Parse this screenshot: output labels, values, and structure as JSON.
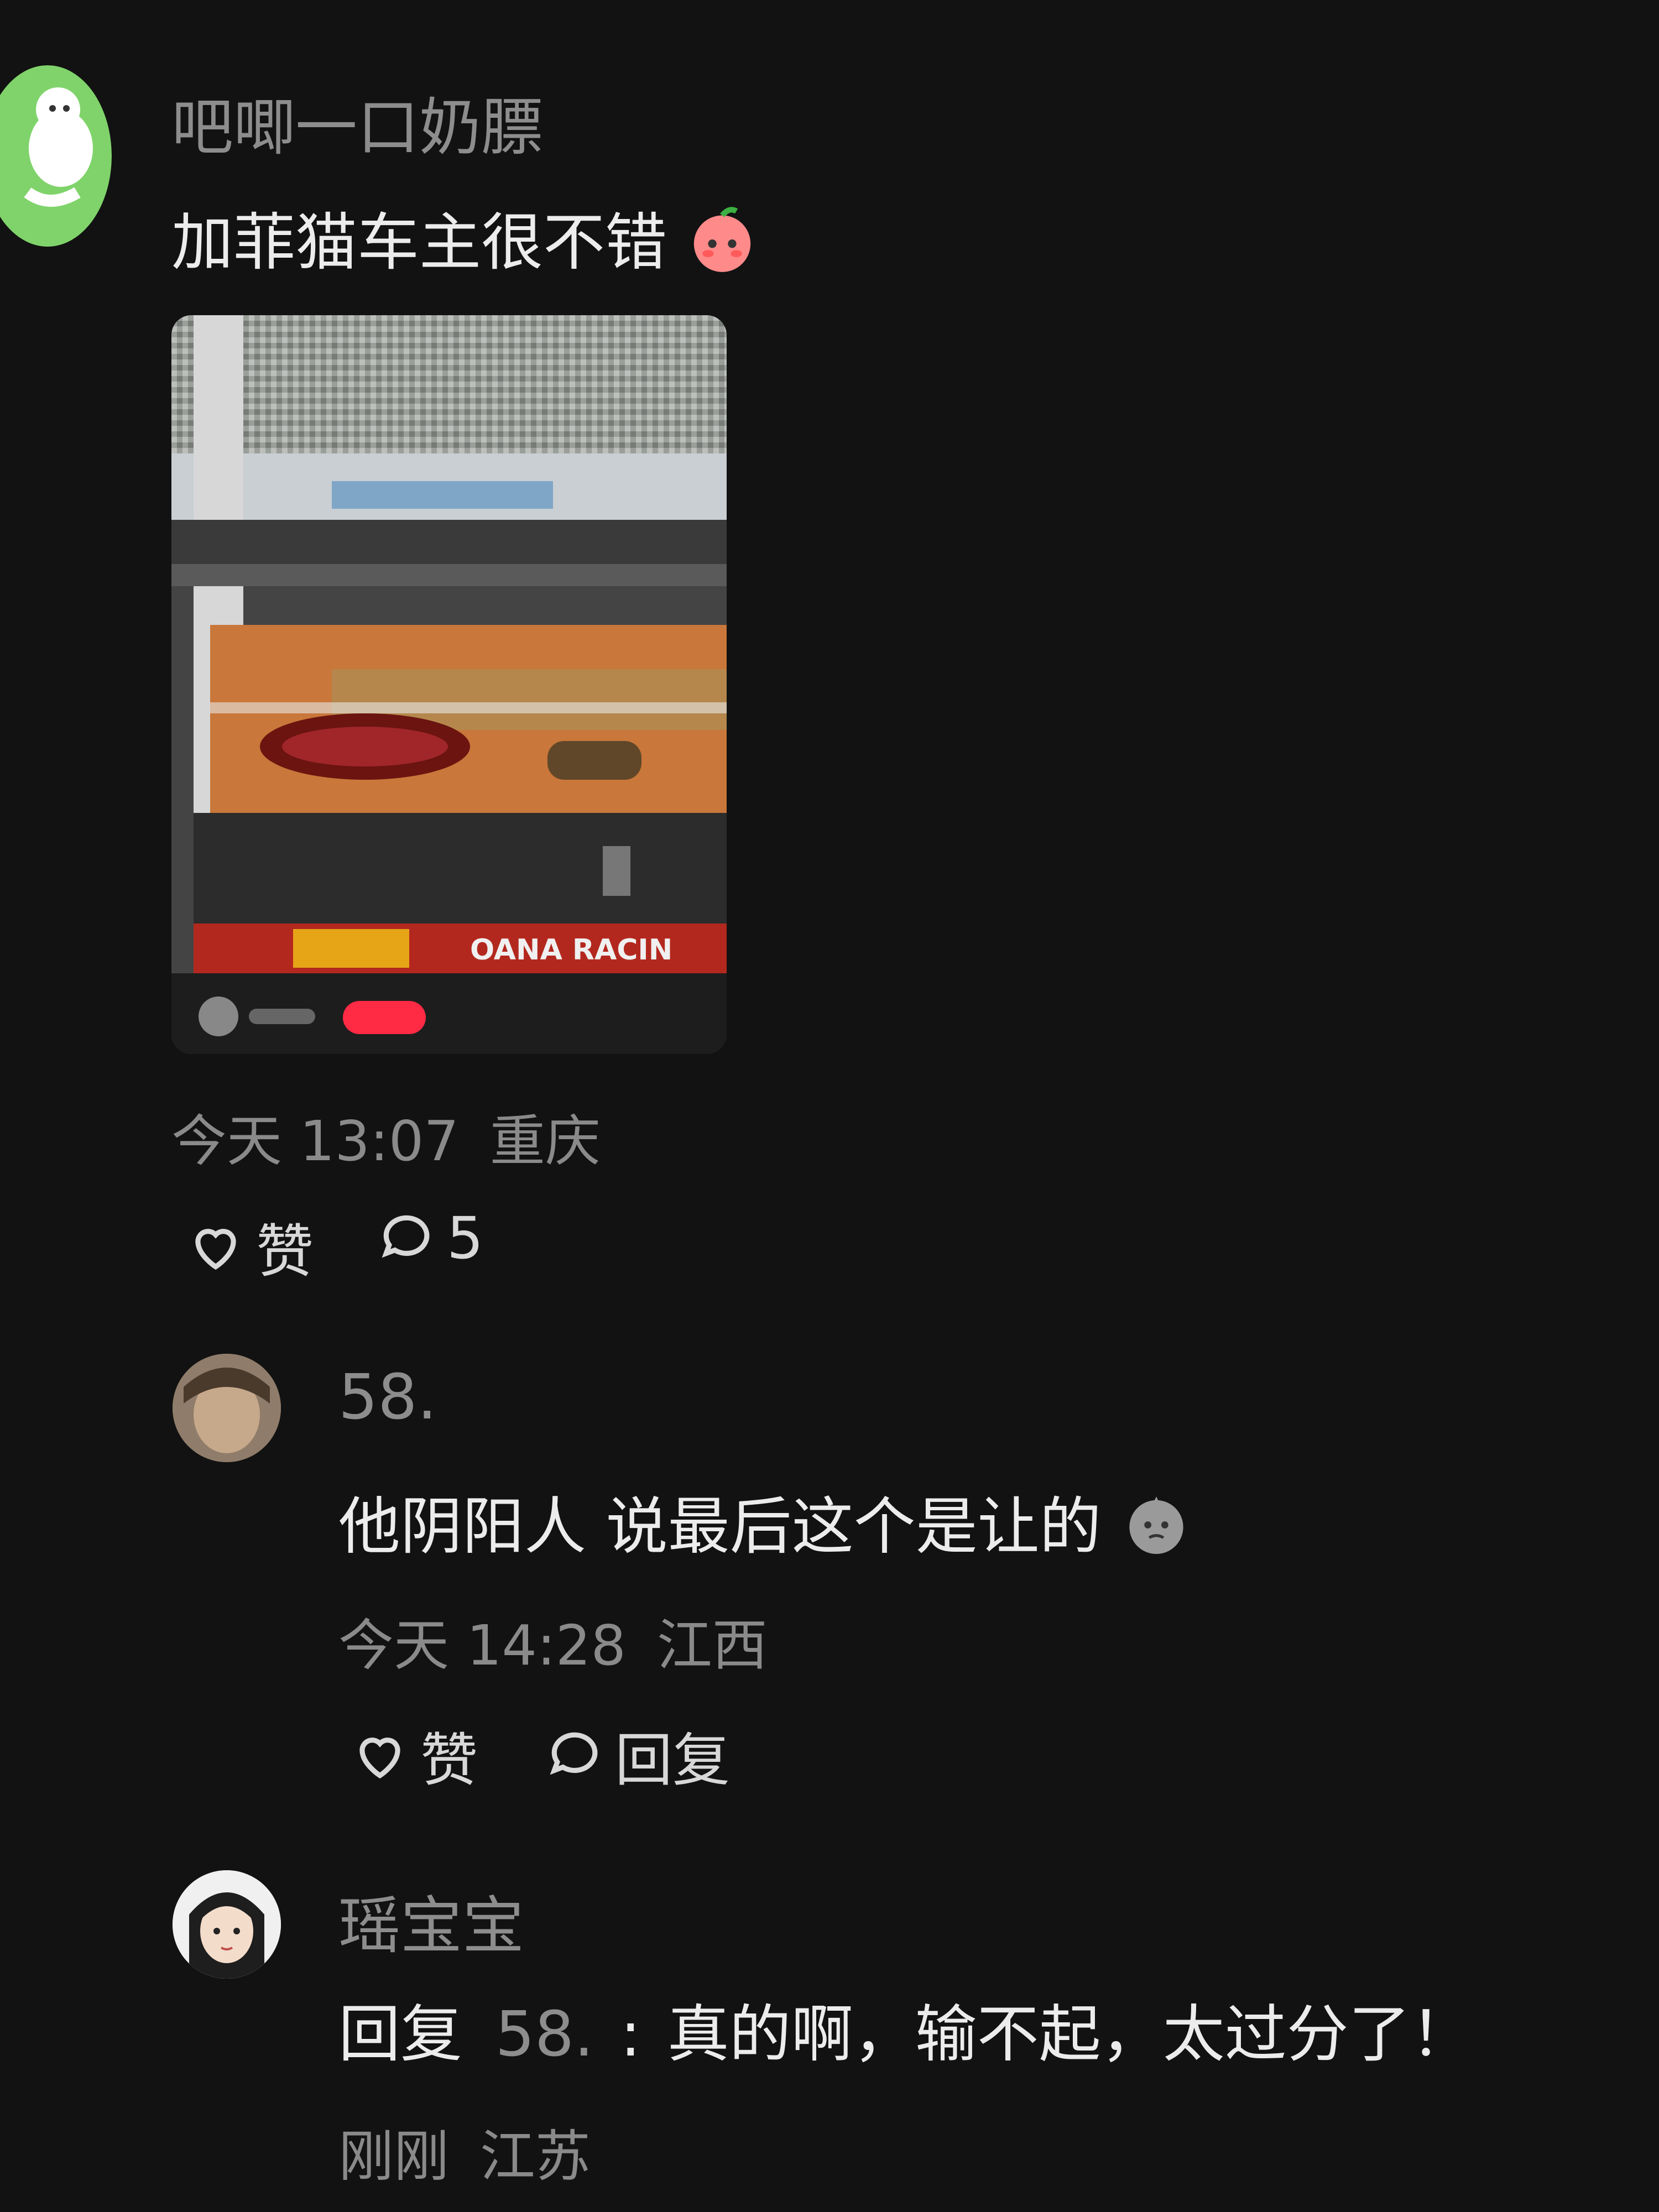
{
  "post": {
    "author": "吧唧一口奶膘",
    "text": "加菲猫车主很不错",
    "emoji_icon": "peach-blush-emoji",
    "image": {
      "plate_text": "OANA RACIN",
      "badge_color": "#ff2a44"
    },
    "timestamp": "今天 13:07",
    "location": "重庆",
    "like_label": "赞",
    "comment_count": "5"
  },
  "replies": [
    {
      "author": "58.",
      "text": "他阴阳人 说最后这个是让的",
      "emoji_icon": "grey-face-emoji",
      "timestamp": "今天 14:28",
      "location": "江西",
      "like_label": "赞",
      "reply_label": "回复"
    },
    {
      "author": "瑶宝宝",
      "reply_prefix": "回复",
      "reply_target": "58.",
      "separator": ":",
      "text": "真的啊，输不起，太过分了！",
      "timestamp": "刚刚",
      "location": "江苏"
    }
  ],
  "colors": {
    "background": "#121212",
    "avatar_green": "#7fd36a",
    "car_orange": "#c9773a"
  }
}
